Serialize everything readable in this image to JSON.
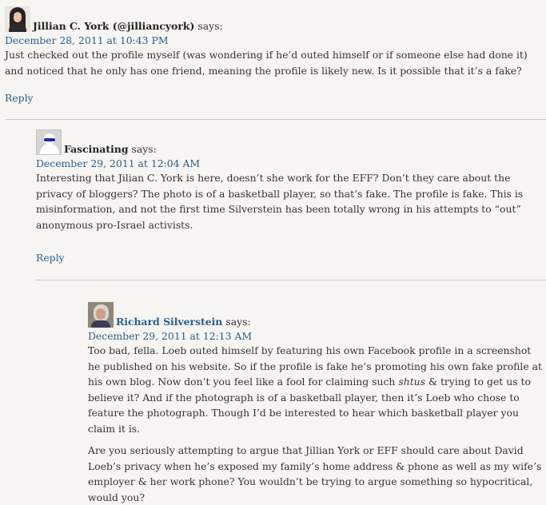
{
  "comments": [
    {
      "author": "Jillian C. York (@jilliancyork)",
      "says": "says:",
      "date": "December 28, 2011 at 10:43 PM",
      "paragraphs": [
        "Just checked out the profile myself (was wondering if he’d outed himself or if someone else had done it) and noticed that he only has one friend, meaning the profile is likely new. Is it possible that it’s a fake?"
      ],
      "reply": "Reply"
    },
    {
      "author": "Fascinating",
      "says": "says:",
      "date": "December 29, 2011 at 12:04 AM",
      "paragraphs": [
        "Interesting that Jilian C. York is here, doesn’t she work for the EFF? Don’t they care about the privacy of bloggers? The photo is of a basketball player, so that’s fake. The profile is fake. This is misinformation, and not the first time Silverstein has been totally wrong in his attempts to “out” anonymous pro-Israel activists."
      ],
      "reply": "Reply"
    },
    {
      "author": "Richard Silverstein",
      "says": "says:",
      "date": "December 29, 2011 at 12:13 AM",
      "p1_before": "Too bad, fella. Loeb outed himself by featuring his own Facebook profile in a screenshot he published on his website. So if the profile is fake he’s promoting his own fake profile at his own blog. Now don’t you feel like a fool for claiming such ",
      "p1_emph": "shtus",
      "p1_after": " & trying to get us to believe it? And if the photograph is of a basketball player, then it’s Loeb who chose to feature the photograph. Though I’d be interested to hear which basketball player you claim it is.",
      "p2": "Are you seriously attempting to argue that Jillian York or EFF should care about David Loeb’s privacy when he’s exposed my family’s home address & phone as well as my wife’s employer & her work phone? You wouldn’t be trying to argue something so hypocritical, would you?"
    }
  ]
}
